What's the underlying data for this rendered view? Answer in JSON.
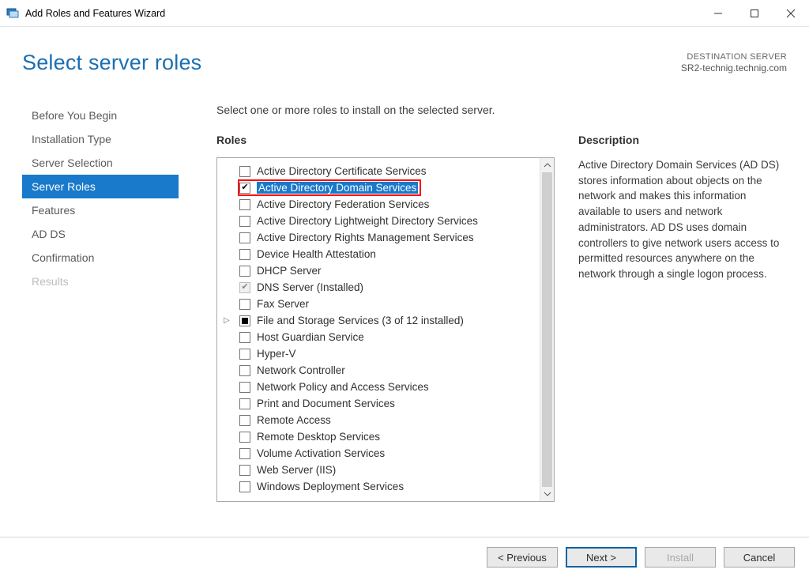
{
  "window": {
    "title": "Add Roles and Features Wizard"
  },
  "header": {
    "page_title": "Select server roles",
    "destination_label": "DESTINATION SERVER",
    "destination_value": "SR2-technig.technig.com"
  },
  "sidebar": {
    "items": [
      {
        "label": "Before You Begin",
        "state": "normal"
      },
      {
        "label": "Installation Type",
        "state": "normal"
      },
      {
        "label": "Server Selection",
        "state": "normal"
      },
      {
        "label": "Server Roles",
        "state": "selected"
      },
      {
        "label": "Features",
        "state": "normal"
      },
      {
        "label": "AD DS",
        "state": "normal"
      },
      {
        "label": "Confirmation",
        "state": "normal"
      },
      {
        "label": "Results",
        "state": "disabled"
      }
    ]
  },
  "main": {
    "instruction": "Select one or more roles to install on the selected server.",
    "roles_heading": "Roles",
    "description_heading": "Description",
    "description_text": "Active Directory Domain Services (AD DS) stores information about objects on the network and makes this information available to users and network administrators. AD DS uses domain controllers to give network users access to permitted resources anywhere on the network through a single logon process.",
    "roles": [
      {
        "label": "Active Directory Certificate Services",
        "check": "unchecked"
      },
      {
        "label": "Active Directory Domain Services",
        "check": "checked",
        "selected": true,
        "highlight": true
      },
      {
        "label": "Active Directory Federation Services",
        "check": "unchecked"
      },
      {
        "label": "Active Directory Lightweight Directory Services",
        "check": "unchecked"
      },
      {
        "label": "Active Directory Rights Management Services",
        "check": "unchecked"
      },
      {
        "label": "Device Health Attestation",
        "check": "unchecked"
      },
      {
        "label": "DHCP Server",
        "check": "unchecked"
      },
      {
        "label": "DNS Server (Installed)",
        "check": "checked-disabled"
      },
      {
        "label": "Fax Server",
        "check": "unchecked"
      },
      {
        "label": "File and Storage Services (3 of 12 installed)",
        "check": "indeterminate",
        "expandable": true
      },
      {
        "label": "Host Guardian Service",
        "check": "unchecked"
      },
      {
        "label": "Hyper-V",
        "check": "unchecked"
      },
      {
        "label": "Network Controller",
        "check": "unchecked"
      },
      {
        "label": "Network Policy and Access Services",
        "check": "unchecked"
      },
      {
        "label": "Print and Document Services",
        "check": "unchecked"
      },
      {
        "label": "Remote Access",
        "check": "unchecked"
      },
      {
        "label": "Remote Desktop Services",
        "check": "unchecked"
      },
      {
        "label": "Volume Activation Services",
        "check": "unchecked"
      },
      {
        "label": "Web Server (IIS)",
        "check": "unchecked"
      },
      {
        "label": "Windows Deployment Services",
        "check": "unchecked"
      }
    ]
  },
  "footer": {
    "previous": "< Previous",
    "next": "Next >",
    "install": "Install",
    "cancel": "Cancel"
  }
}
